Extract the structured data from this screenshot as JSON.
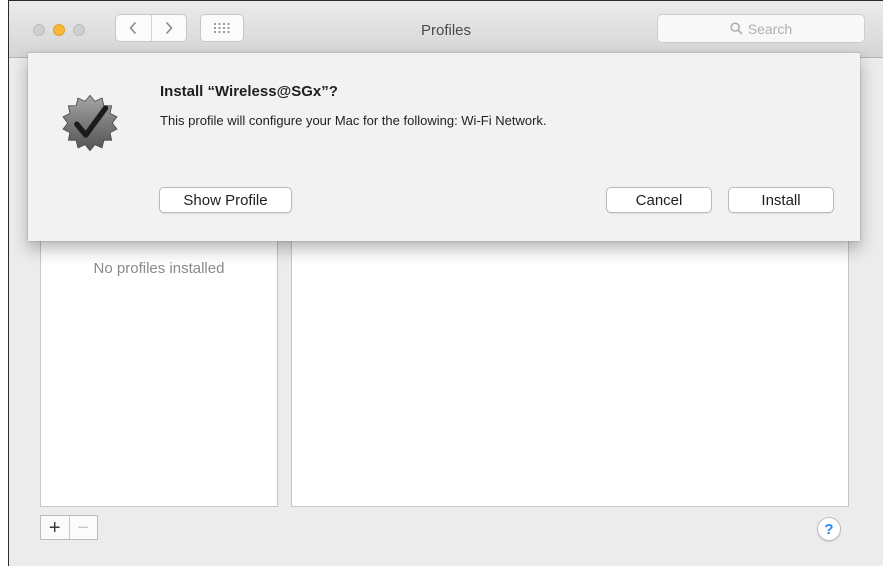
{
  "window": {
    "title": "Profiles"
  },
  "toolbar": {
    "back_icon": "chevron-left-icon",
    "forward_icon": "chevron-right-icon",
    "grid_icon": "grid-dots-icon",
    "search_placeholder": "Search"
  },
  "profiles_list": {
    "empty_message": "No profiles installed"
  },
  "bottom_bar": {
    "add_label": "+",
    "remove_label": "−",
    "help_label": "?"
  },
  "dialog": {
    "title": "Install “Wireless@SGx”?",
    "message": "This profile will configure your Mac for the following: Wi-Fi Network.",
    "show_profile_label": "Show Profile",
    "cancel_label": "Cancel",
    "install_label": "Install",
    "icon": "verified-checkmark-badge-icon"
  },
  "colors": {
    "accent": "#2f86f5",
    "minimize": "#f6b93a",
    "window_bg": "#ececec"
  }
}
